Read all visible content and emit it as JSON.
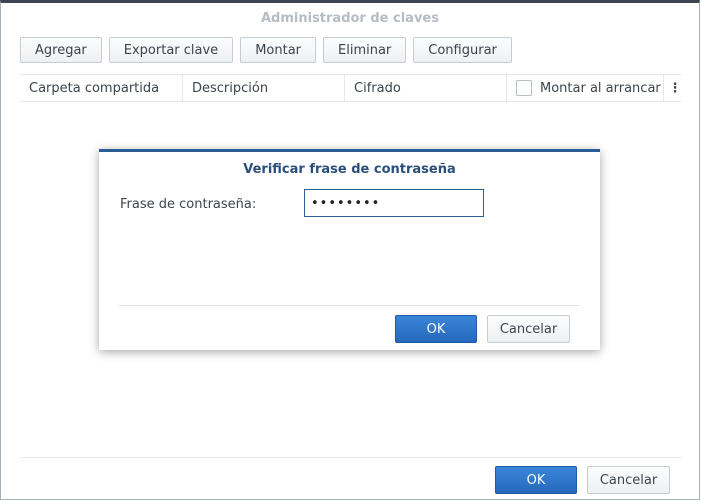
{
  "window": {
    "title": "Administrador de claves"
  },
  "toolbar": {
    "buttons": [
      "Agregar",
      "Exportar clave",
      "Montar",
      "Eliminar",
      "Configurar"
    ]
  },
  "grid": {
    "columns": [
      "Carpeta compartida",
      "Descripción",
      "Cifrado",
      "Montar al arrancar"
    ],
    "menu_icon": "kebab-menu-icon",
    "mount_checkbox_checked": false
  },
  "footer": {
    "ok_label": "OK",
    "cancel_label": "Cancelar"
  },
  "dialog": {
    "title": "Verificar frase de contraseña",
    "field_label": "Frase de contraseña:",
    "password_value": "12345678",
    "ok_label": "OK",
    "cancel_label": "Cancelar"
  },
  "colors": {
    "accent": "#2668bc",
    "dialog_border": "#2a5d97",
    "title_muted": "#b6bcc3"
  }
}
